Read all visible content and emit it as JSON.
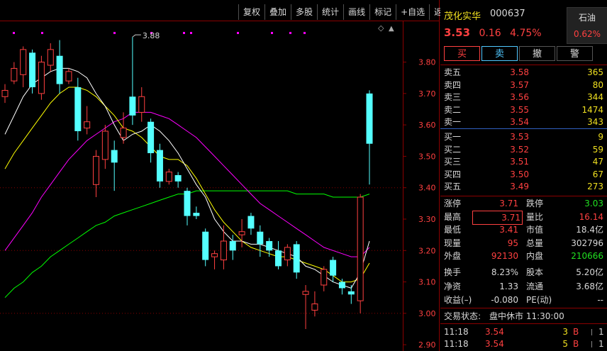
{
  "toolbar": [
    "复权",
    "叠加",
    "多股",
    "统计",
    "画线",
    "标记",
    "+自选",
    "返回"
  ],
  "chart": {
    "high_label": "3.88",
    "y_ticks": [
      "3.80",
      "3.70",
      "3.60",
      "3.50",
      "3.40",
      "3.30",
      "3.20",
      "3.10",
      "3.00",
      "2.90"
    ],
    "y_range": [
      2.88,
      3.93
    ],
    "colors": {
      "up": "#ff4040",
      "down": "#54ffff",
      "ma5": "#ffffff",
      "ma10": "#ffff00",
      "ma20": "#ff00ff",
      "ma60": "#00ff00"
    }
  },
  "chart_data": {
    "type": "candlestick",
    "candles": [
      [
        3.69,
        3.71,
        3.67,
        3.73
      ],
      [
        3.74,
        3.78,
        3.73,
        3.8
      ],
      [
        3.76,
        3.84,
        3.72,
        3.85
      ],
      [
        3.83,
        3.72,
        3.7,
        3.84
      ],
      [
        3.7,
        3.8,
        3.68,
        3.82
      ],
      [
        3.79,
        3.84,
        3.77,
        3.86
      ],
      [
        3.82,
        3.73,
        3.7,
        3.87
      ],
      [
        3.74,
        3.77,
        3.73,
        3.78
      ],
      [
        3.72,
        3.58,
        3.55,
        3.75
      ],
      [
        3.59,
        3.61,
        3.57,
        3.66
      ],
      [
        3.41,
        3.5,
        3.37,
        3.52
      ],
      [
        3.49,
        3.58,
        3.46,
        3.6
      ],
      [
        3.52,
        3.48,
        3.39,
        3.55
      ],
      [
        3.56,
        3.59,
        3.54,
        3.64
      ],
      [
        3.69,
        3.63,
        3.6,
        3.88
      ],
      [
        3.64,
        3.69,
        3.61,
        3.72
      ],
      [
        3.61,
        3.51,
        3.48,
        3.62
      ],
      [
        3.52,
        3.42,
        3.4,
        3.54
      ],
      [
        3.42,
        3.45,
        3.41,
        3.46
      ],
      [
        3.44,
        3.42,
        3.4,
        3.45
      ],
      [
        3.39,
        3.31,
        3.28,
        3.4
      ],
      [
        3.32,
        3.31,
        3.3,
        3.34
      ],
      [
        3.26,
        3.17,
        3.15,
        3.27
      ],
      [
        3.18,
        3.19,
        3.14,
        3.2
      ],
      [
        3.17,
        3.23,
        3.14,
        3.28
      ],
      [
        3.23,
        3.2,
        3.17,
        3.25
      ],
      [
        3.25,
        3.26,
        3.21,
        3.3
      ],
      [
        3.31,
        3.27,
        3.25,
        3.32
      ],
      [
        3.26,
        3.22,
        3.18,
        3.28
      ],
      [
        3.23,
        3.2,
        3.18,
        3.24
      ],
      [
        3.2,
        3.15,
        3.14,
        3.23
      ],
      [
        3.17,
        3.21,
        3.15,
        3.22
      ],
      [
        3.22,
        3.13,
        3.11,
        3.23
      ],
      [
        3.06,
        3.07,
        2.95,
        3.09
      ],
      [
        3.01,
        3.03,
        2.99,
        3.07
      ],
      [
        3.09,
        3.14,
        3.07,
        3.15
      ],
      [
        3.17,
        3.12,
        3.1,
        3.18
      ],
      [
        3.1,
        3.08,
        3.06,
        3.11
      ],
      [
        3.07,
        3.06,
        3.03,
        3.09
      ],
      [
        3.04,
        3.37,
        3.0,
        3.38
      ],
      [
        3.7,
        3.54,
        3.41,
        3.71
      ]
    ],
    "ma5": [
      3.57,
      3.63,
      3.69,
      3.73,
      3.75,
      3.77,
      3.78,
      3.78,
      3.77,
      3.75,
      3.7,
      3.66,
      3.6,
      3.55,
      3.57,
      3.58,
      3.6,
      3.58,
      3.55,
      3.51,
      3.46,
      3.41,
      3.37,
      3.3,
      3.26,
      3.23,
      3.23,
      3.22,
      3.22,
      3.21,
      3.2,
      3.19,
      3.18,
      3.15,
      3.14,
      3.12,
      3.1,
      3.09,
      3.08,
      3.13,
      3.23
    ],
    "ma10": [
      3.46,
      3.51,
      3.55,
      3.59,
      3.63,
      3.67,
      3.7,
      3.72,
      3.72,
      3.71,
      3.69,
      3.66,
      3.63,
      3.59,
      3.58,
      3.56,
      3.53,
      3.5,
      3.49,
      3.49,
      3.47,
      3.43,
      3.38,
      3.33,
      3.29,
      3.26,
      3.23,
      3.21,
      3.2,
      3.19,
      3.18,
      3.18,
      3.17,
      3.16,
      3.15,
      3.14,
      3.12,
      3.1,
      3.1,
      3.11,
      3.16
    ],
    "ma20": [
      3.2,
      3.24,
      3.28,
      3.32,
      3.37,
      3.41,
      3.45,
      3.49,
      3.52,
      3.55,
      3.57,
      3.59,
      3.61,
      3.62,
      3.64,
      3.64,
      3.64,
      3.63,
      3.62,
      3.6,
      3.58,
      3.56,
      3.53,
      3.5,
      3.47,
      3.44,
      3.41,
      3.38,
      3.35,
      3.33,
      3.31,
      3.29,
      3.27,
      3.25,
      3.23,
      3.21,
      3.2,
      3.19,
      3.18,
      3.18,
      3.21
    ],
    "ma60": [
      3.05,
      3.08,
      3.1,
      3.13,
      3.15,
      3.18,
      3.2,
      3.22,
      3.24,
      3.26,
      3.28,
      3.29,
      3.31,
      3.32,
      3.33,
      3.34,
      3.35,
      3.36,
      3.37,
      3.38,
      3.38,
      3.39,
      3.39,
      3.39,
      3.39,
      3.39,
      3.39,
      3.39,
      3.39,
      3.39,
      3.39,
      3.39,
      3.38,
      3.38,
      3.38,
      3.38,
      3.37,
      3.37,
      3.37,
      3.37,
      3.38
    ]
  },
  "quote": {
    "name": "茂化实华",
    "code": "000637",
    "sector": "石油",
    "sector_pct": "0.62%",
    "price": "3.53",
    "change": "0.16",
    "pct": "4.75%"
  },
  "actions": [
    "买",
    "卖",
    "撤",
    "警"
  ],
  "asks": [
    {
      "label": "卖五",
      "price": "3.58",
      "vol": "365"
    },
    {
      "label": "卖四",
      "price": "3.57",
      "vol": "80"
    },
    {
      "label": "卖三",
      "price": "3.56",
      "vol": "344"
    },
    {
      "label": "卖二",
      "price": "3.55",
      "vol": "1474"
    },
    {
      "label": "卖一",
      "price": "3.54",
      "vol": "343"
    }
  ],
  "bids": [
    {
      "label": "买一",
      "price": "3.53",
      "vol": "9"
    },
    {
      "label": "买二",
      "price": "3.52",
      "vol": "59"
    },
    {
      "label": "买三",
      "price": "3.51",
      "vol": "47"
    },
    {
      "label": "买四",
      "price": "3.50",
      "vol": "67"
    },
    {
      "label": "买五",
      "price": "3.49",
      "vol": "273"
    }
  ],
  "stats": [
    {
      "l1": "涨停",
      "v1": "3.71",
      "c1": "red",
      "l2": "跌停",
      "v2": "3.03",
      "c2": "green"
    },
    {
      "l1": "最高",
      "v1": "3.71",
      "c1": "red boxed",
      "l2": "量比",
      "v2": "16.14",
      "c2": "red"
    },
    {
      "l1": "最低",
      "v1": "3.41",
      "c1": "red",
      "l2": "市值",
      "v2": "18.4亿",
      "c2": "wht"
    },
    {
      "l1": "现量",
      "v1": "95",
      "c1": "red",
      "l2": "总量",
      "v2": "302796",
      "c2": "wht"
    },
    {
      "l1": "外盘",
      "v1": "92130",
      "c1": "red",
      "l2": "内盘",
      "v2": "210666",
      "c2": "green"
    },
    {
      "l1": "换手",
      "v1": "8.23%",
      "c1": "wht",
      "l2": "股本",
      "v2": "5.20亿",
      "c2": "wht"
    },
    {
      "l1": "净资",
      "v1": "1.33",
      "c1": "wht",
      "l2": "流通",
      "v2": "3.68亿",
      "c2": "wht"
    },
    {
      "l1": "收益(–)",
      "v1": "-0.080",
      "c1": "wht",
      "l2": "PE(动)",
      "v2": "--",
      "c2": "wht"
    }
  ],
  "status": {
    "label": "交易状态:",
    "value": "盘中休市 11:30:00"
  },
  "ticks": [
    {
      "time": "11:18",
      "price": "3.54",
      "vol": "3",
      "side": "B",
      "count": "1"
    },
    {
      "time": "11:18",
      "price": "3.54",
      "vol": "5",
      "side": "B",
      "count": "1"
    }
  ]
}
